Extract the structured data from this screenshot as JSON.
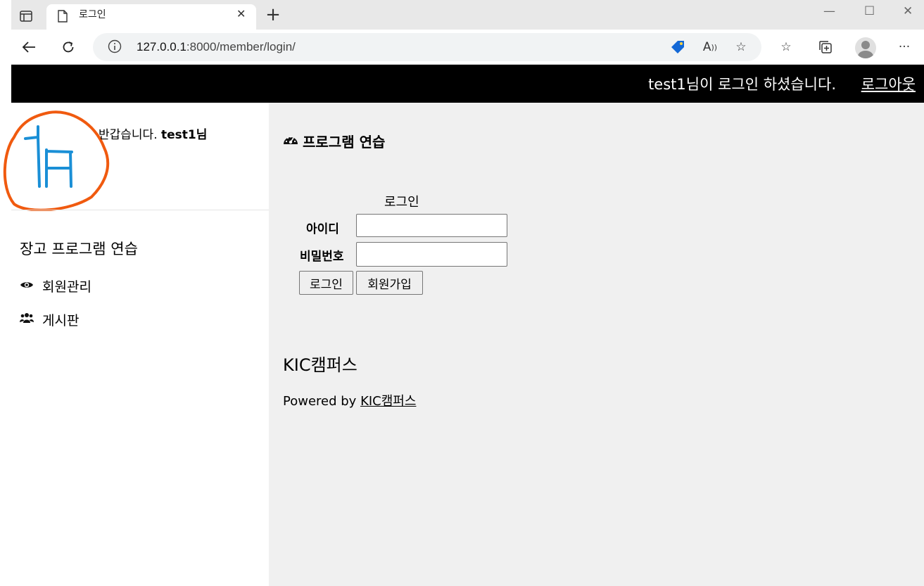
{
  "browser": {
    "tab_title": "로그인",
    "url_host": "127.0.0.1",
    "url_rest": ":8000/member/login/"
  },
  "header": {
    "greeting": "test1님이 로그인 하셨습니다.",
    "logout_label": "로그아웃"
  },
  "sidebar": {
    "welcome_text": "반갑습니다.",
    "welcome_user": "test1님",
    "title": "장고 프로그램 연습",
    "items": [
      {
        "label": "회원관리",
        "icon": "eye-icon"
      },
      {
        "label": "게시판",
        "icon": "users-icon"
      }
    ]
  },
  "main": {
    "title": "프로그램 연습",
    "form": {
      "caption": "로그인",
      "id_label": "아이디",
      "password_label": "비밀번호",
      "id_value": "",
      "password_value": "",
      "login_button": "로그인",
      "signup_button": "회원가입"
    },
    "footer_title": "KIC캠퍼스",
    "powered_by": "Powered by",
    "powered_link": "KIC캠퍼스"
  },
  "colors": {
    "header_bg": "#000000",
    "main_bg": "#f0f0f0",
    "logo_blue": "#1a8fd6",
    "logo_circle": "#f05a0f"
  }
}
